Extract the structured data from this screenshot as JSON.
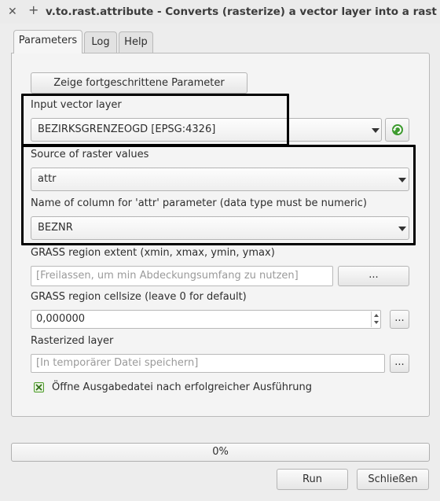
{
  "window": {
    "close_glyph": "✕",
    "pin_glyph": "+",
    "title": "v.to.rast.attribute - Converts (rasterize) a vector layer into a rast"
  },
  "tabs": [
    {
      "label": "Parameters",
      "active": true
    },
    {
      "label": "Log",
      "active": false
    },
    {
      "label": "Help",
      "active": false
    }
  ],
  "advanced_button": "Zeige fortgeschrittene Parameter",
  "input_layer": {
    "label": "Input vector layer",
    "value": "BEZIRKSGRENZEOGD [EPSG:4326]"
  },
  "source": {
    "label": "Source of raster values",
    "value": "attr"
  },
  "column": {
    "label": "Name of column for 'attr' parameter (data type must be numeric)",
    "value": "BEZNR"
  },
  "extent": {
    "label": "GRASS region extent (xmin, xmax, ymin, ymax)",
    "placeholder": "[Freilassen, um min Abdeckungsumfang zu nutzen]",
    "button": "..."
  },
  "cellsize": {
    "label": "GRASS region cellsize (leave 0 for default)",
    "value": "0,000000",
    "button": "..."
  },
  "output": {
    "label": "Rasterized layer",
    "placeholder": "[In temporärer Datei speichern]",
    "button": "..."
  },
  "open_output": {
    "label": "Öffne Ausgabedatei nach erfolgreicher Ausführung",
    "checked": true
  },
  "progress": {
    "text": "0%",
    "value": 0
  },
  "buttons": {
    "run": "Run",
    "close": "Schließen"
  },
  "colors": {
    "highlight": "#000000",
    "refresh_icon": "#3e9b2f",
    "checkbox": "#4c9a2a"
  },
  "icons": [
    "close-icon",
    "pin-icon",
    "dropdown-arrow-icon",
    "refresh-icon",
    "spin-up-icon",
    "spin-down-icon",
    "checkbox-checked-icon"
  ]
}
